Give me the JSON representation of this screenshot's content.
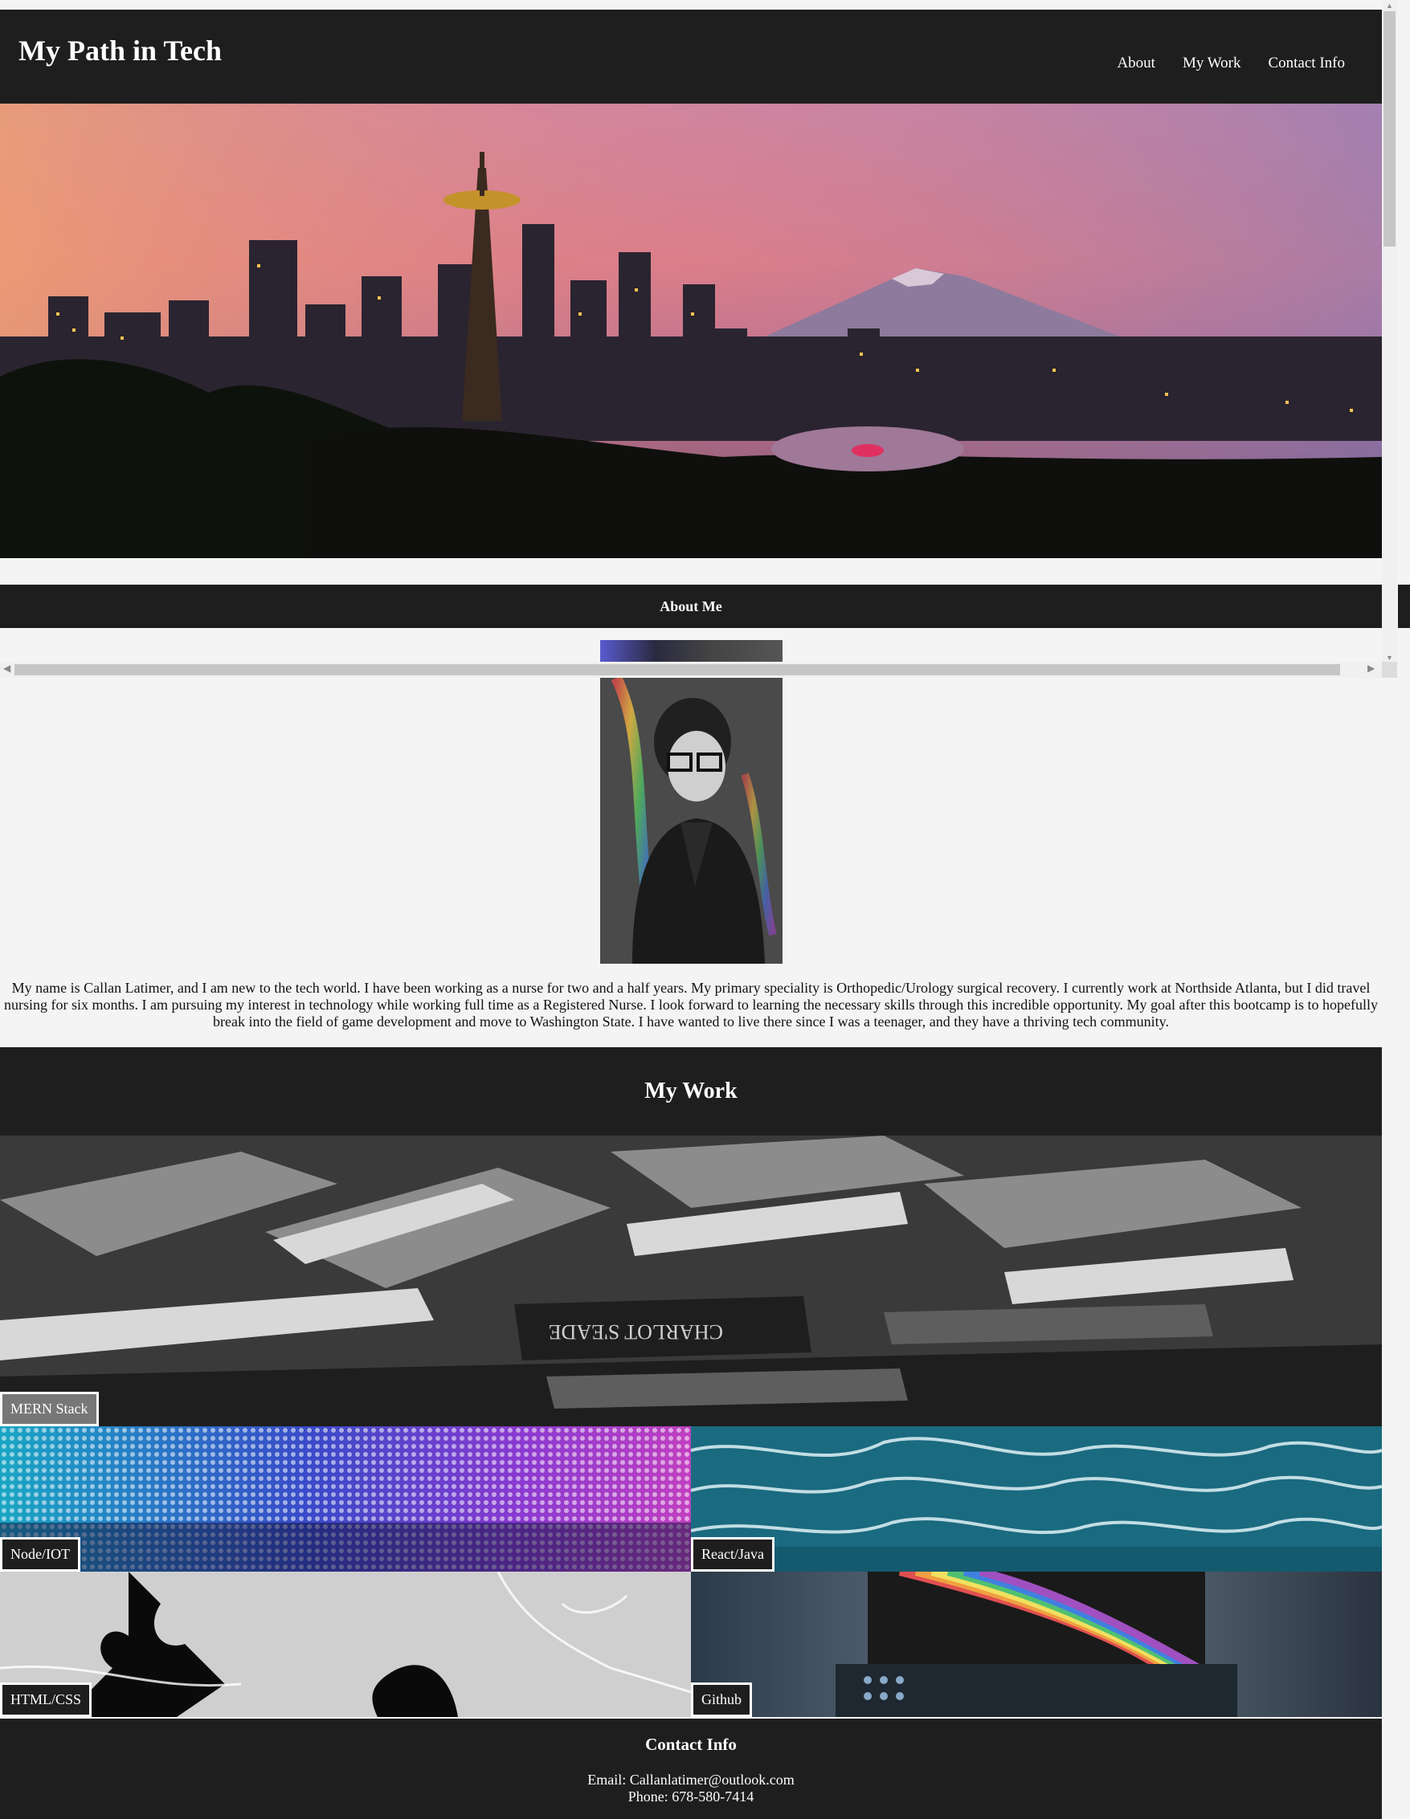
{
  "header": {
    "title": "My Path in Tech",
    "nav": [
      "About",
      "My Work",
      "Contact Info"
    ]
  },
  "about": {
    "heading": "About Me",
    "text": "My name is Callan Latimer, and I am new to the tech world. I have been working as a nurse for two and a half years. My primary speciality is Orthopedic/Urology surgical recovery. I currently work at Northside Atlanta, but I did travel nursing for six months. I am pursuing my interest in technology while working full time as a Registered Nurse. I look forward to learning the necessary skills through this incredible opportunity. My goal after this bootcamp is to hopefully break into the field of game development and move to Washington State. I have wanted to live there since I was a teenager, and they have a thriving tech community."
  },
  "work": {
    "heading": "My Work",
    "tiles": [
      "MERN Stack",
      "Node/IOT",
      "React/Java",
      "HTML/CSS",
      "Github"
    ]
  },
  "contact": {
    "heading": "Contact Info",
    "email": "Email: Callanlatimer@outlook.com",
    "phone": "Phone: 678-580-7414"
  },
  "colors": {
    "dark": "#1e1e1e",
    "page_bg": "#f4f4f4",
    "text_light": "#ffffff"
  }
}
